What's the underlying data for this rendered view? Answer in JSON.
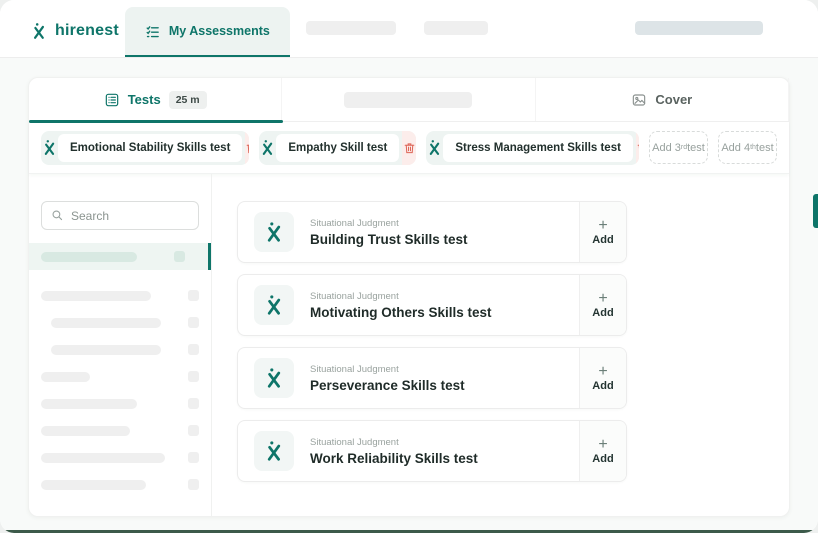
{
  "brand": {
    "name": "hirenest",
    "accent_color": "#0E7569",
    "danger_color": "#DD6557",
    "bottom_bar_color": "#3C5A4A"
  },
  "header": {
    "nav_active_label": "My Assessments"
  },
  "tabs": {
    "tests_label": "Tests",
    "tests_duration_badge": "25 m",
    "cover_label": "Cover"
  },
  "selected_tests": [
    {
      "name": "Emotional Stability Skills test"
    },
    {
      "name": "Empathy Skill test"
    },
    {
      "name": "Stress Management Skills test"
    }
  ],
  "add_slots": [
    {
      "prefix": "Add 3",
      "sup": "rd",
      "suffix": " test"
    },
    {
      "prefix": "Add 4",
      "sup": "th",
      "suffix": " test"
    }
  ],
  "sidebar": {
    "search_placeholder": "Search"
  },
  "available_tests": [
    {
      "category": "Situational Judgment",
      "name": "Building Trust Skills test"
    },
    {
      "category": "Situational Judgment",
      "name": "Motivating Others Skills test"
    },
    {
      "category": "Situational Judgment",
      "name": "Perseverance Skills test"
    },
    {
      "category": "Situational Judgment",
      "name": "Work Reliability Skills test"
    }
  ],
  "add_button": {
    "plus": "+",
    "label": "Add"
  }
}
